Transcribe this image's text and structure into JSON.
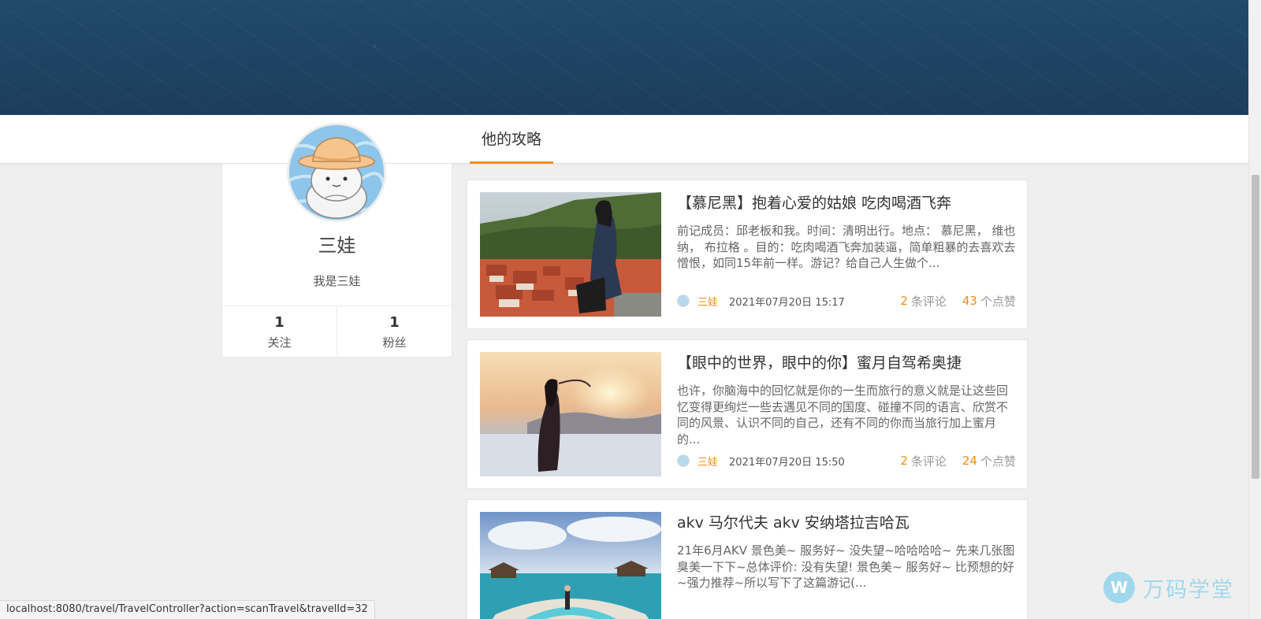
{
  "profile": {
    "name": "三娃",
    "bio": "我是三娃",
    "following_count": "1",
    "following_label": "关注",
    "followers_count": "1",
    "followers_label": "粉丝"
  },
  "tabs": [
    {
      "label": "他的攻略",
      "active": true
    }
  ],
  "articles": [
    {
      "title": "【慕尼黑】抱着心爱的姑娘 吃肉喝酒飞奔",
      "excerpt": "前记成员：邱老板和我。时间：清明出行。地点： 慕尼黑， 维也纳， 布拉格 。目的：吃肉喝酒飞奔加装逼，简单粗暴的去喜欢去憎恨，如同15年前一样。游记？给自己人生做个...",
      "author": "三娃",
      "date": "2021年07月20日 15:17",
      "comments": "2",
      "comments_label": "条评论",
      "likes": "43",
      "likes_label": "个点赞"
    },
    {
      "title": "【眼中的世界，眼中的你】蜜月自驾希奥捷",
      "excerpt": "也许，你脑海中的回忆就是你的一生而旅行的意义就是让这些回忆变得更绚烂一些去遇见不同的国度、碰撞不同的语言、欣赏不同的风景、认识不同的自己，还有不同的你而当旅行加上蜜月的...",
      "author": "三娃",
      "date": "2021年07月20日 15:50",
      "comments": "2",
      "comments_label": "条评论",
      "likes": "24",
      "likes_label": "个点赞"
    },
    {
      "title": "akv 马尔代夫 akv 安纳塔拉吉哈瓦",
      "excerpt": "21年6月AKV 景色美~ 服务好~ 没失望~哈哈哈哈~ 先来几张图 臭美一下下~总体评价: 没有失望! 景色美~ 服务好~ 比预想的好~强力推荐~所以写下了这篇游记(..."
    }
  ],
  "status_url": "localhost:8080/travel/TravelController?action=scanTravel&travelId=32",
  "watermark": {
    "logo_glyph": "W",
    "text": "万码学堂"
  },
  "colors": {
    "banner": "#1f4463",
    "accent": "#f28c1a",
    "watermark": "#9fd8ec"
  },
  "icons": [
    "cat-bucket-hat-avatar",
    "mini-avatar-icon",
    "wanma-logo-icon"
  ]
}
